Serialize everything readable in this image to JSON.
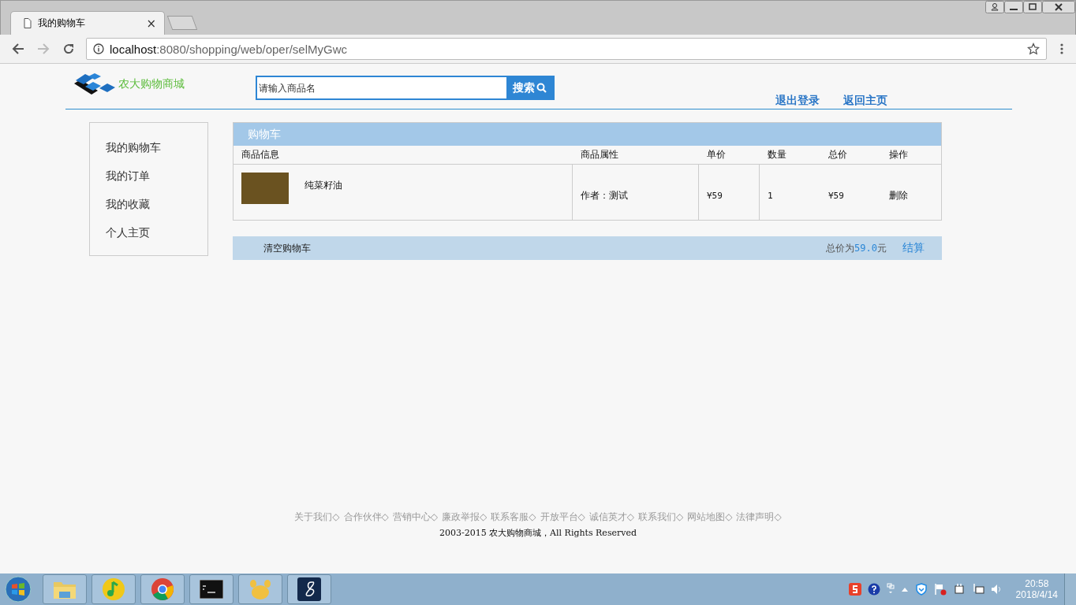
{
  "browser": {
    "tab": {
      "title": "我的购物车",
      "close": "×"
    },
    "url_host": "localhost",
    "url_path": ":8080/shopping/web/oper/selMyGwc"
  },
  "header": {
    "logo_text": "农大购物商城",
    "search": {
      "placeholder": "请输入商品名",
      "button": "搜索"
    },
    "links": [
      "退出登录",
      "返回主页"
    ]
  },
  "sidebar": {
    "items": [
      "我的购物车",
      "我的订单",
      "我的收藏",
      "个人主页"
    ]
  },
  "cart": {
    "title": "购物车",
    "columns": [
      "商品信息",
      "商品属性",
      "单价",
      "数量",
      "总价",
      "操作"
    ],
    "rows": [
      {
        "name": "纯菜籽油",
        "attribute": "作者：测试",
        "unit_price": "¥59",
        "quantity": "1",
        "total": "¥59",
        "action": "删除"
      }
    ]
  },
  "cart_footer": {
    "clear": "清空购物车",
    "total_label": "总价为",
    "total_value": "59.0",
    "total_unit": "元",
    "checkout": "结算"
  },
  "footer": {
    "links": [
      "关于我们◇",
      "合作伙伴◇",
      "营销中心◇",
      "廉政举报◇",
      "联系客服◇",
      "开放平台◇",
      "诚信英才◇",
      "联系我们◇",
      "网站地图◇",
      "法律声明◇"
    ],
    "copyright": "2003-2015 农大购物商城，All Rights Reserved"
  },
  "taskbar": {
    "time": "20:58",
    "date": "2018/4/14"
  }
}
